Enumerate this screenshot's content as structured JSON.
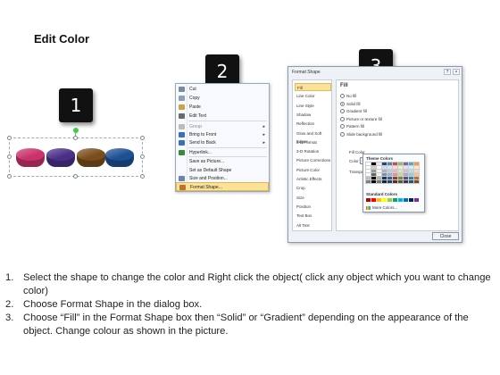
{
  "title": "Edit Color",
  "step_numbers": [
    "1",
    "2",
    "3"
  ],
  "shapes": {
    "colors": [
      "#c9326a",
      "#4a2f88",
      "#7a4d1c",
      "#1d4f93"
    ]
  },
  "context_menu": {
    "items": [
      {
        "label": "Cut",
        "icon": "scissors-icon",
        "icon_color": "#7a8aa0"
      },
      {
        "label": "Copy",
        "icon": "copy-icon",
        "icon_color": "#8aa0bb"
      },
      {
        "label": "Paste",
        "icon": "clipboard-icon",
        "icon_color": "#caa24a"
      },
      {
        "label": "Edit Text",
        "icon": "text-icon",
        "icon_color": "#6a6a6a"
      },
      {
        "label": "Group",
        "icon": "group-icon",
        "icon_color": "#bbbbbb",
        "dim": true,
        "submenu": true
      },
      {
        "label": "Bring to Front",
        "icon": "bring-front-icon",
        "icon_color": "#3a6fc0",
        "submenu": true
      },
      {
        "label": "Send to Back",
        "icon": "send-back-icon",
        "icon_color": "#3a6fc0",
        "submenu": true
      },
      {
        "label": "Hyperlink...",
        "icon": "globe-icon",
        "icon_color": "#3a8a3a"
      },
      {
        "label": "Save as Picture...",
        "icon": "",
        "icon_color": ""
      },
      {
        "label": "Set as Default Shape",
        "icon": "",
        "icon_color": ""
      },
      {
        "label": "Size and Position...",
        "icon": "size-icon",
        "icon_color": "#6a86b0"
      },
      {
        "label": "Format Shape...",
        "icon": "format-shape-icon",
        "icon_color": "#c07030",
        "highlighted": true
      }
    ]
  },
  "format_dialog": {
    "title": "Format Shape",
    "categories": [
      "Fill",
      "Line Color",
      "Line Style",
      "Shadow",
      "Reflection",
      "Glow and Soft Edges",
      "3-D Format",
      "3-D Rotation",
      "Picture Corrections",
      "Picture Color",
      "Artistic Effects",
      "Crop",
      "Size",
      "Position",
      "Text Box",
      "Alt Text"
    ],
    "selected_category": "Fill",
    "fill_heading": "Fill",
    "fill_options": [
      {
        "label": "No fill",
        "checked": false
      },
      {
        "label": "Solid fill",
        "checked": true
      },
      {
        "label": "Gradient fill",
        "checked": false
      },
      {
        "label": "Picture or texture fill",
        "checked": false
      },
      {
        "label": "Pattern fill",
        "checked": false
      },
      {
        "label": "Slide background fill",
        "checked": false
      }
    ],
    "fill_color_label": "Fill Color",
    "color_label": "Color:",
    "transparency_label": "Transpa",
    "close_label": "Close"
  },
  "color_popup": {
    "theme_heading": "Theme Colors",
    "standard_heading": "Standard Colors",
    "more_label": "More Colors...",
    "theme_top": [
      "#ffffff",
      "#000000",
      "#eeece1",
      "#1f497d",
      "#4f81bd",
      "#c0504d",
      "#9bbb59",
      "#8064a2",
      "#4bacc6",
      "#f79646"
    ],
    "standard": [
      "#c00000",
      "#ff0000",
      "#ffc000",
      "#ffff00",
      "#92d050",
      "#00b050",
      "#00b0f0",
      "#0070c0",
      "#002060",
      "#7030a0"
    ]
  },
  "instructions": [
    {
      "n": "1.",
      "text": "Select the shape to change the color and Right click the object( click any object which you want to change color)"
    },
    {
      "n": "2.",
      "text": "Choose Format Shape in the dialog box."
    },
    {
      "n": "3.",
      "text": "Choose “Fill” in the Format Shape box then “Solid” or “Gradient” depending on the appearance of the object. Change colour as shown in the picture."
    }
  ]
}
